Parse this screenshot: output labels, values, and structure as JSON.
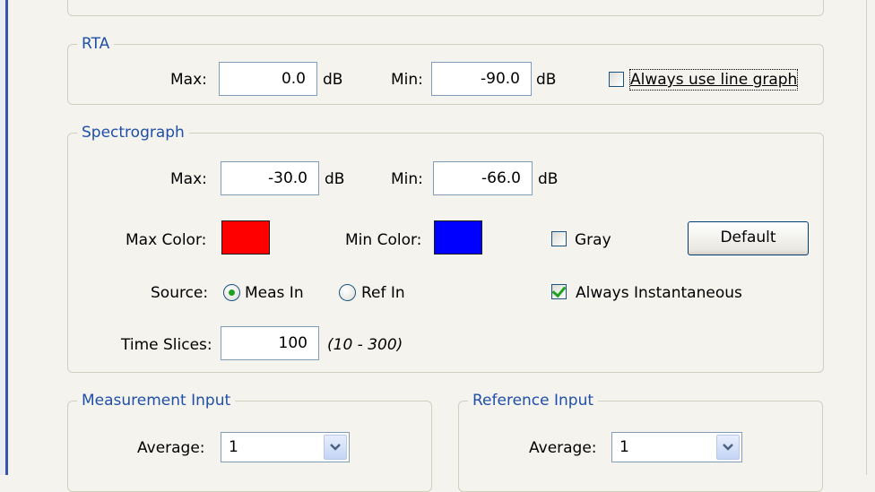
{
  "rta": {
    "title": "RTA",
    "max_label": "Max:",
    "max_value": "0.0",
    "max_unit": "dB",
    "min_label": "Min:",
    "min_value": "-90.0",
    "min_unit": "dB",
    "always_line_graph_label": "Always use line graph",
    "always_line_graph_checked": false
  },
  "spectrograph": {
    "title": "Spectrograph",
    "max_label": "Max:",
    "max_value": "-30.0",
    "max_unit": "dB",
    "min_label": "Min:",
    "min_value": "-66.0",
    "min_unit": "dB",
    "max_color_label": "Max Color:",
    "max_color": "#ff0000",
    "min_color_label": "Min Color:",
    "min_color": "#0000ff",
    "gray_label": "Gray",
    "gray_checked": false,
    "default_button": "Default",
    "source_label": "Source:",
    "source_options": [
      "Meas In",
      "Ref In"
    ],
    "source_selected": "Meas In",
    "always_instantaneous_label": "Always Instantaneous",
    "always_instantaneous_checked": true,
    "time_slices_label": "Time Slices:",
    "time_slices_value": "100",
    "time_slices_range": "(10 - 300)"
  },
  "measurement_input": {
    "title": "Measurement Input",
    "average_label": "Average:",
    "average_value": "1"
  },
  "reference_input": {
    "title": "Reference Input",
    "average_label": "Average:",
    "average_value": "1"
  },
  "colors": {
    "frame_accent": "#3a55a8",
    "legend_text": "#1f4fa8",
    "check_green": "#21a121"
  }
}
